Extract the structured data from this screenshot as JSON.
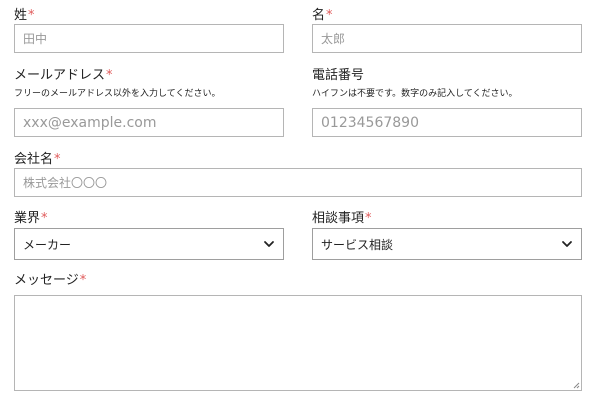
{
  "form": {
    "last_name": {
      "label": "姓",
      "required_mark": "*",
      "placeholder": "田中"
    },
    "first_name": {
      "label": "名",
      "required_mark": "*",
      "placeholder": "太郎"
    },
    "email": {
      "label": "メールアドレス",
      "required_mark": "*",
      "note": "フリーのメールアドレス以外を入力してください。",
      "placeholder": "xxx@example.com"
    },
    "phone": {
      "label": "電話番号",
      "note": "ハイフンは不要です。数字のみ記入してください。",
      "placeholder": "01234567890"
    },
    "company": {
      "label": "会社名",
      "required_mark": "*",
      "placeholder": "株式会社〇〇〇"
    },
    "industry": {
      "label": "業界",
      "required_mark": "*",
      "selected": "メーカー"
    },
    "topic": {
      "label": "相談事項",
      "required_mark": "*",
      "selected": "サービス相談"
    },
    "message": {
      "label": "メッセージ",
      "required_mark": "*"
    }
  },
  "colors": {
    "required": "#e05a5a",
    "border": "#b5b5b5",
    "placeholder": "#999999"
  },
  "icons": {
    "select_chevron": "chevron-down-icon",
    "resize": "resize-grip-icon"
  }
}
